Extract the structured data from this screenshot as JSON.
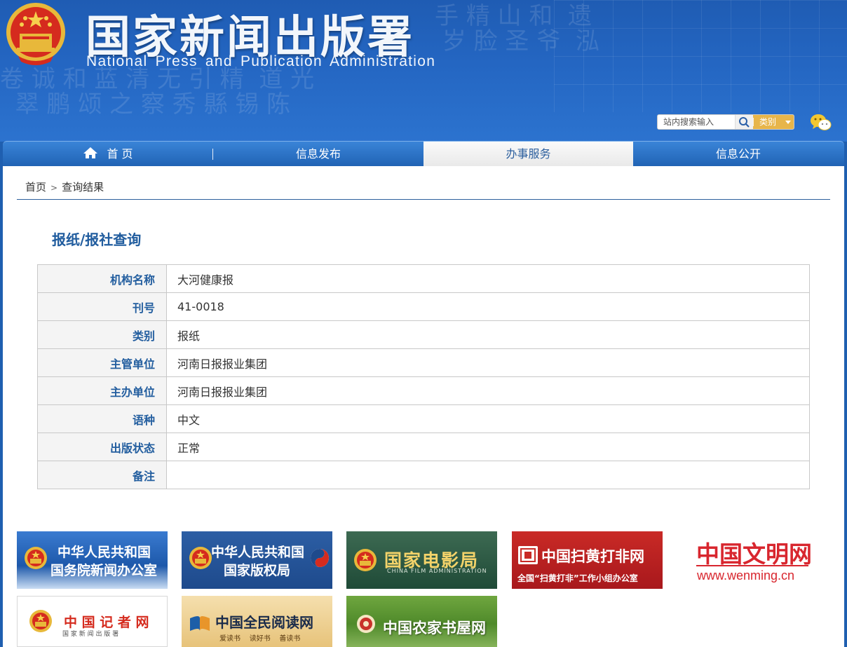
{
  "header": {
    "title": "国家新闻出版署",
    "subtitle": "National  Press and Publication Administration",
    "search_placeholder": "站内搜索输入",
    "category_label": "类别"
  },
  "nav": {
    "items": [
      {
        "label": "首 页"
      },
      {
        "label": "信息发布"
      },
      {
        "label": "办事服务"
      },
      {
        "label": "信息公开"
      }
    ]
  },
  "breadcrumb": {
    "home": "首页",
    "separator": ">",
    "current": "查询结果"
  },
  "page": {
    "heading": "报纸/报社查询"
  },
  "record": {
    "rows": [
      {
        "label": "机构名称",
        "value": "大河健康报"
      },
      {
        "label": "刊号",
        "value": "41-0018"
      },
      {
        "label": "类别",
        "value": "报纸"
      },
      {
        "label": "主管单位",
        "value": "河南日报报业集团"
      },
      {
        "label": "主办单位",
        "value": "河南日报报业集团"
      },
      {
        "label": "语种",
        "value": "中文"
      },
      {
        "label": "出版状态",
        "value": "正常"
      },
      {
        "label": "备注",
        "value": ""
      }
    ]
  },
  "links": {
    "scio": {
      "line1": "中华人民共和国",
      "line2": "国务院新闻办公室"
    },
    "ncac": {
      "line1": "中华人民共和国",
      "line2": "国家版权局"
    },
    "film": {
      "name": "国家电影局",
      "english": "CHINA FILM ADMINISTRATION"
    },
    "shdf": {
      "name": "中国扫黄打非网",
      "sub": "全国“扫黄打非”工作小组办公室"
    },
    "wenming": {
      "name": "中国文明网",
      "url": "www.wenming.cn"
    },
    "journalist": {
      "name": "中 国 记 者 网",
      "sub": "国 家 新 闻 出 版 署"
    },
    "reading": {
      "name": "中国全民阅读网",
      "slogan": "爱读书    读好书    善读书"
    },
    "farm": {
      "name": "中国农家书屋网"
    }
  },
  "colors": {
    "header_blue": "#2466c2",
    "title_blue": "#205c9e",
    "table_label_blue": "#235e9f",
    "category_gold": "#e7b54a",
    "wenming_red": "#d8262e"
  }
}
